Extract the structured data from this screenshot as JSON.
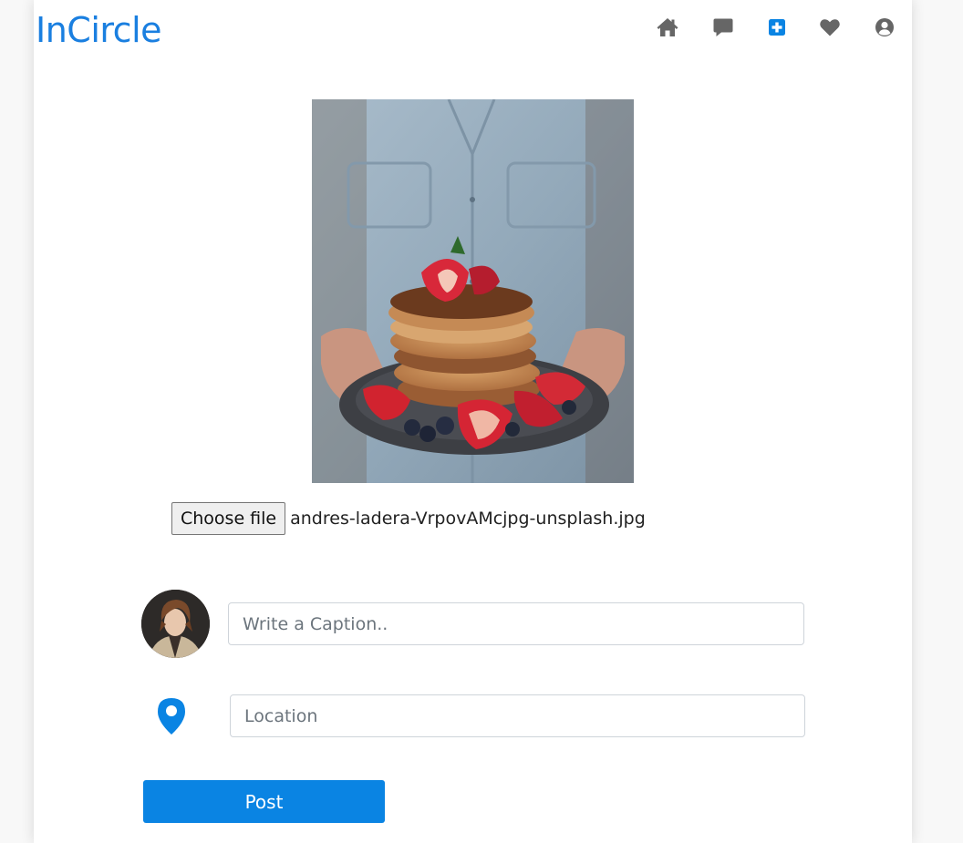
{
  "app": {
    "logo": "InCircle",
    "accent_color": "#1a7fe0"
  },
  "nav": {
    "items": [
      {
        "icon": "home-icon",
        "color": "#666666"
      },
      {
        "icon": "message-icon",
        "color": "#666666"
      },
      {
        "icon": "add-post-icon",
        "color": "#0a84e3",
        "active": true
      },
      {
        "icon": "heart-icon",
        "color": "#666666"
      },
      {
        "icon": "profile-icon",
        "color": "#666666"
      }
    ]
  },
  "upload": {
    "preview_alt": "pancake stack with strawberries",
    "choose_file_label": "Choose file",
    "file_name": "andres-ladera-VrpovAMcjpg-unsplash.jpg"
  },
  "form": {
    "caption_placeholder": "Write a Caption..",
    "caption_value": "",
    "location_placeholder": "Location",
    "location_value": "",
    "location_icon": "map-pin-icon",
    "avatar": "user-avatar",
    "post_label": "Post",
    "post_color": "#0a84e3"
  }
}
